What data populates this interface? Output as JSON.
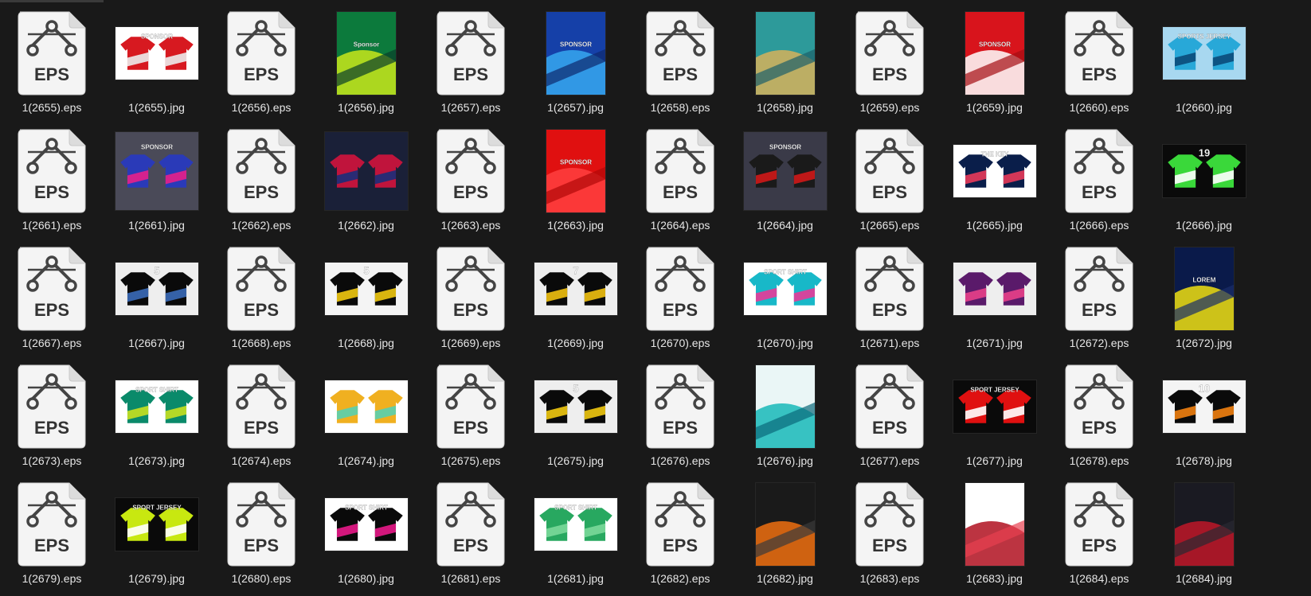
{
  "icons": {
    "eps": "eps-vector-file-icon",
    "jpg": "jpg-image-thumbnail"
  },
  "colors": {
    "background": "#191919",
    "label": "#e6e6e6",
    "eps_page": "#f4f4f4",
    "eps_glyph": "#444444"
  },
  "eps_label": "EPS",
  "files": [
    {
      "name": "1(2655).eps",
      "type": "eps"
    },
    {
      "name": "1(2655).jpg",
      "type": "jpg",
      "shape": "wide",
      "colors": [
        "#ffffff",
        "#d71920",
        "#ececec"
      ],
      "text": "SPONSOR"
    },
    {
      "name": "1(2656).eps",
      "type": "eps"
    },
    {
      "name": "1(2656).jpg",
      "type": "jpg",
      "shape": "tall",
      "colors": [
        "#0c7a3c",
        "#c9e81a",
        "#0a3f2a"
      ],
      "text": "Sponsor"
    },
    {
      "name": "1(2657).eps",
      "type": "eps"
    },
    {
      "name": "1(2657).jpg",
      "type": "jpg",
      "shape": "tall",
      "colors": [
        "#1540a8",
        "#36a8f0",
        "#0e2a6e"
      ],
      "text": "SPONSOR"
    },
    {
      "name": "1(2658).eps",
      "type": "eps"
    },
    {
      "name": "1(2658).jpg",
      "type": "jpg",
      "shape": "tall",
      "colors": [
        "#2d9a9a",
        "#d6b25a",
        "#1d5f6a"
      ],
      "text": ""
    },
    {
      "name": "1(2659).eps",
      "type": "eps"
    },
    {
      "name": "1(2659).jpg",
      "type": "jpg",
      "shape": "tall",
      "colors": [
        "#d8141c",
        "#ffffff",
        "#a50d12"
      ],
      "text": "SPONSOR"
    },
    {
      "name": "1(2660).eps",
      "type": "eps"
    },
    {
      "name": "1(2660).jpg",
      "type": "jpg",
      "shape": "wide",
      "colors": [
        "#a8d8f0",
        "#28a8d8",
        "#0a4a7a"
      ],
      "text": "SPORTS JERSEY"
    },
    {
      "name": "1(2661).eps",
      "type": "eps"
    },
    {
      "name": "1(2661).jpg",
      "type": "jpg",
      "shape": "square",
      "colors": [
        "#4a4a58",
        "#2a3ab8",
        "#e8208a"
      ],
      "text": "SPONSOR"
    },
    {
      "name": "1(2662).eps",
      "type": "eps"
    },
    {
      "name": "1(2662).jpg",
      "type": "jpg",
      "shape": "square",
      "colors": [
        "#1a2038",
        "#c0143c",
        "#1a2e7a"
      ],
      "text": ""
    },
    {
      "name": "1(2663).eps",
      "type": "eps"
    },
    {
      "name": "1(2663).jpg",
      "type": "jpg",
      "shape": "tall",
      "colors": [
        "#e01010",
        "#ff4040",
        "#b00808"
      ],
      "text": "SPONSOR"
    },
    {
      "name": "1(2664).eps",
      "type": "eps"
    },
    {
      "name": "1(2664).jpg",
      "type": "jpg",
      "shape": "square",
      "colors": [
        "#3a3a48",
        "#1a1a1a",
        "#d01818"
      ],
      "text": "SPONSOR"
    },
    {
      "name": "1(2665).eps",
      "type": "eps"
    },
    {
      "name": "1(2665).jpg",
      "type": "jpg",
      "shape": "wide",
      "colors": [
        "#ffffff",
        "#0a1e4a",
        "#e83a5a"
      ],
      "text": "THE KEY"
    },
    {
      "name": "1(2666).eps",
      "type": "eps"
    },
    {
      "name": "1(2666).jpg",
      "type": "jpg",
      "shape": "wide",
      "colors": [
        "#0a0a0a",
        "#3ad83a",
        "#ffffff"
      ],
      "text": "19"
    },
    {
      "name": "1(2667).eps",
      "type": "eps"
    },
    {
      "name": "1(2667).jpg",
      "type": "jpg",
      "shape": "wide",
      "colors": [
        "#eeeeee",
        "#0a0a0a",
        "#3a6ab8"
      ],
      "text": "5"
    },
    {
      "name": "1(2668).eps",
      "type": "eps"
    },
    {
      "name": "1(2668).jpg",
      "type": "jpg",
      "shape": "wide",
      "colors": [
        "#f4f4f4",
        "#0a0a0a",
        "#f0c810"
      ],
      "text": "5"
    },
    {
      "name": "1(2669).eps",
      "type": "eps"
    },
    {
      "name": "1(2669).jpg",
      "type": "jpg",
      "shape": "wide",
      "colors": [
        "#eeeeee",
        "#0a0a0a",
        "#f0c010"
      ],
      "text": "7"
    },
    {
      "name": "1(2670).eps",
      "type": "eps"
    },
    {
      "name": "1(2670).jpg",
      "type": "jpg",
      "shape": "wide",
      "colors": [
        "#ffffff",
        "#18b8c8",
        "#e83a98"
      ],
      "text": "SPORT SHIRT"
    },
    {
      "name": "1(2671).eps",
      "type": "eps"
    },
    {
      "name": "1(2671).jpg",
      "type": "jpg",
      "shape": "wide",
      "colors": [
        "#eeeeee",
        "#5a1a6a",
        "#e8408a"
      ],
      "text": ""
    },
    {
      "name": "1(2672).eps",
      "type": "eps"
    },
    {
      "name": "1(2672).jpg",
      "type": "jpg",
      "shape": "tall",
      "colors": [
        "#0a1a4a",
        "#f0e010",
        "#1a2e6a"
      ],
      "text": "LOREM"
    },
    {
      "name": "1(2673).eps",
      "type": "eps"
    },
    {
      "name": "1(2673).jpg",
      "type": "jpg",
      "shape": "wide",
      "colors": [
        "#ffffff",
        "#0a8a6a",
        "#c8e020"
      ],
      "text": "SPORT SHIRT"
    },
    {
      "name": "1(2674).eps",
      "type": "eps"
    },
    {
      "name": "1(2674).jpg",
      "type": "jpg",
      "shape": "wide",
      "colors": [
        "#ffffff",
        "#f0b020",
        "#58d0b0"
      ],
      "text": ""
    },
    {
      "name": "1(2675).eps",
      "type": "eps"
    },
    {
      "name": "1(2675).jpg",
      "type": "jpg",
      "shape": "wide",
      "colors": [
        "#eeeeee",
        "#0a0a0a",
        "#f0c810"
      ],
      "text": "5"
    },
    {
      "name": "1(2676).eps",
      "type": "eps"
    },
    {
      "name": "1(2676).jpg",
      "type": "jpg",
      "shape": "tall",
      "colors": [
        "#eaf6f6",
        "#18b8b8",
        "#0a6a7a"
      ],
      "text": ""
    },
    {
      "name": "1(2677).eps",
      "type": "eps"
    },
    {
      "name": "1(2677).jpg",
      "type": "jpg",
      "shape": "wide",
      "colors": [
        "#0a0a0a",
        "#e01010",
        "#ffffff"
      ],
      "text": "SPORT JERSEY"
    },
    {
      "name": "1(2678).eps",
      "type": "eps"
    },
    {
      "name": "1(2678).jpg",
      "type": "jpg",
      "shape": "wide",
      "colors": [
        "#f4f4f4",
        "#0a0a0a",
        "#f08010"
      ],
      "text": "10"
    },
    {
      "name": "1(2679).eps",
      "type": "eps"
    },
    {
      "name": "1(2679).jpg",
      "type": "jpg",
      "shape": "wide",
      "colors": [
        "#0a0a0a",
        "#c8e810",
        "#ffffff"
      ],
      "text": "SPORT JERSEY"
    },
    {
      "name": "1(2680).eps",
      "type": "eps"
    },
    {
      "name": "1(2680).jpg",
      "type": "jpg",
      "shape": "wide",
      "colors": [
        "#ffffff",
        "#0a0a0a",
        "#e81888"
      ],
      "text": "SPORT SHIRT"
    },
    {
      "name": "1(2681).eps",
      "type": "eps"
    },
    {
      "name": "1(2681).jpg",
      "type": "jpg",
      "shape": "wide",
      "colors": [
        "#ffffff",
        "#28a860",
        "#7ad89a"
      ],
      "text": "SPORT SHIRT"
    },
    {
      "name": "1(2682).eps",
      "type": "eps"
    },
    {
      "name": "1(2682).jpg",
      "type": "jpg",
      "shape": "tall",
      "colors": [
        "#1a1a1a",
        "#f07010",
        "#3a3a3a"
      ],
      "text": ""
    },
    {
      "name": "1(2683).eps",
      "type": "eps"
    },
    {
      "name": "1(2683).jpg",
      "type": "jpg",
      "shape": "tall",
      "colors": [
        "#ffffff",
        "#b01020",
        "#e84050"
      ],
      "text": ""
    },
    {
      "name": "1(2684).eps",
      "type": "eps"
    },
    {
      "name": "1(2684).jpg",
      "type": "jpg",
      "shape": "tall",
      "colors": [
        "#1a1a22",
        "#c01828",
        "#2a2a32"
      ],
      "text": ""
    }
  ]
}
